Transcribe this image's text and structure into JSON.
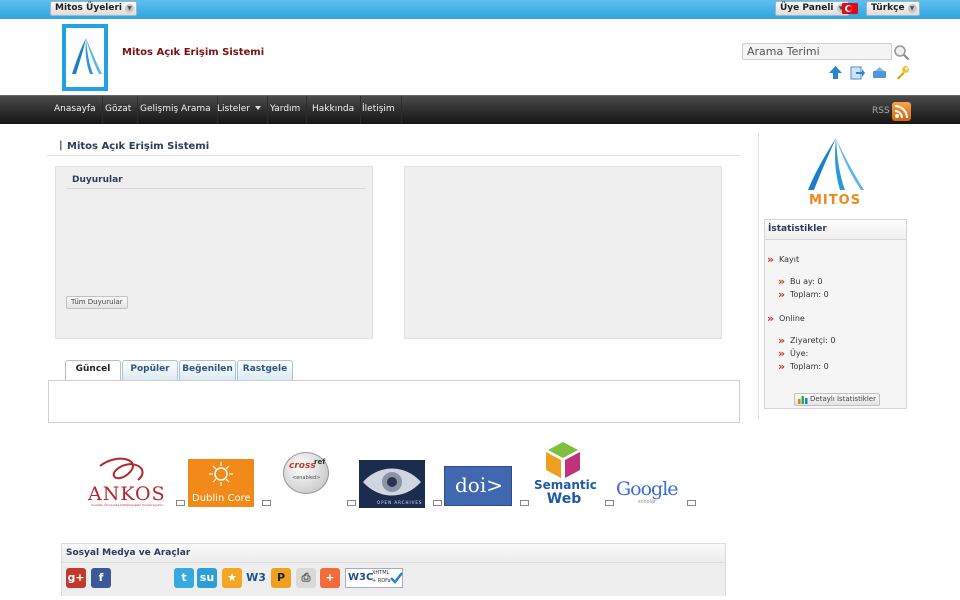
{
  "topbar": {
    "members_label": "Mitos Üyeleri",
    "panel_label": "Üye Paneli",
    "language_label": "Türkçe"
  },
  "header": {
    "site_title": "Mitos Açık Erişim Sistemi",
    "search_placeholder": "Arama Terimi"
  },
  "nav": {
    "items": [
      "Anasayfa",
      "Gözat",
      "Gelişmiş Arama",
      "Listeler",
      "Yardım",
      "Hakkında",
      "İletişim"
    ],
    "rss_label": "RSS"
  },
  "main": {
    "title": "Mitos Açık Erişim Sistemi",
    "announcements": {
      "title": "Duyurular",
      "all_button": "Tüm Duyurular"
    },
    "tabs": [
      "Güncel",
      "Popüler",
      "Beğenilen",
      "Rastgele"
    ]
  },
  "partners": {
    "ankos": "ANKOS",
    "ankos_sub": "Anadolu Üniversite Kütüphaneleri Konsorsiyumu",
    "dublin_core": "Dublin Core",
    "crossref": "cross",
    "crossref_ref": "ref",
    "crossref_enabled": "<enabled>",
    "open_archives": "OPEN ARCHIVES",
    "doi": "doi>",
    "semantic_web_line1": "Semantic",
    "semantic_web_line2": "Web",
    "google_scholar": "Google",
    "google_scholar_sub": "scholar"
  },
  "social": {
    "title": "Sosyal Medya ve Araçlar",
    "icons": [
      "google-plus",
      "facebook",
      "twitter",
      "stumbleupon",
      "favorites",
      "w3",
      "p-badge",
      "print",
      "add"
    ],
    "w3c_main": "W3C",
    "w3c_sub1": "XHTML",
    "w3c_sub2": "+ RDFa"
  },
  "sidebar": {
    "logo_text": "MITOS",
    "stats": {
      "title": "İstatistikler",
      "record_label": "Kayıt",
      "this_month": "Bu ay: 0",
      "total_records": "Toplam: 0",
      "online_label": "Online",
      "visitors": "Ziyaretçi: 0",
      "members": "Üye:",
      "total_online": "Toplam: 0",
      "detail_button": "Detaylı İstatistikler"
    }
  },
  "colors": {
    "topbar": "#2fa3e0",
    "nav": "#1e1e1e",
    "accent_title": "#2c3a5e",
    "site_title": "#7a1010"
  }
}
